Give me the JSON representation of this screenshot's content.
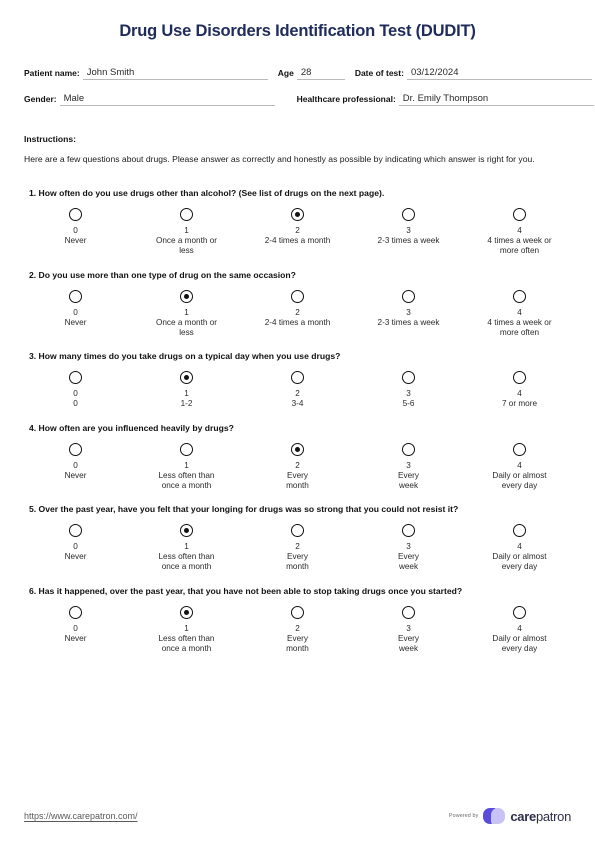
{
  "document": {
    "title": "Drug Use Disorders Identification Test (DUDIT)",
    "title_color": "#1f2b5b"
  },
  "header_fields": {
    "patient_name_label": "Patient name:",
    "patient_name_value": "John Smith",
    "age_label": "Age",
    "age_value": "28",
    "date_label": "Date of test:",
    "date_value": "03/12/2024",
    "gender_label": "Gender:",
    "gender_value": "Male",
    "professional_label": "Healthcare professional:",
    "professional_value": "Dr. Emily Thompson"
  },
  "instructions": {
    "heading": "Instructions:",
    "body": "Here are a few questions about drugs. Please answer as correctly and honestly as possible by indicating which answer is right for you."
  },
  "questions": [
    {
      "text": "1. How often do you use drugs other than alcohol? (See list of drugs on the next page).",
      "selected": 2,
      "options": [
        {
          "value": "0",
          "label": "Never"
        },
        {
          "value": "1",
          "label": "Once a month or\nless"
        },
        {
          "value": "2",
          "label": "2-4 times a month"
        },
        {
          "value": "3",
          "label": "2-3 times a week"
        },
        {
          "value": "4",
          "label": "4 times a week or\nmore often"
        }
      ]
    },
    {
      "text": "2. Do you use more than one type of drug on the same occasion?",
      "selected": 1,
      "options": [
        {
          "value": "0",
          "label": "Never"
        },
        {
          "value": "1",
          "label": "Once a month or\nless"
        },
        {
          "value": "2",
          "label": "2-4 times a month"
        },
        {
          "value": "3",
          "label": "2-3 times a week"
        },
        {
          "value": "4",
          "label": "4 times a week or\nmore often"
        }
      ]
    },
    {
      "text": "3. How many times do you take drugs on a typical day when you use drugs?",
      "selected": 1,
      "options": [
        {
          "value": "0",
          "label": "0"
        },
        {
          "value": "1",
          "label": "1-2"
        },
        {
          "value": "2",
          "label": "3-4"
        },
        {
          "value": "3",
          "label": "5-6"
        },
        {
          "value": "4",
          "label": "7 or more"
        }
      ]
    },
    {
      "text": "4. How often are you influenced heavily by drugs?",
      "selected": 2,
      "options": [
        {
          "value": "0",
          "label": "Never"
        },
        {
          "value": "1",
          "label": "Less often than\nonce a month"
        },
        {
          "value": "2",
          "label": "Every\nmonth"
        },
        {
          "value": "3",
          "label": "Every\nweek"
        },
        {
          "value": "4",
          "label": "Daily or almost\nevery day"
        }
      ]
    },
    {
      "text": "5. Over the past year, have you felt that your longing for drugs was so strong that you could not resist it?",
      "selected": 1,
      "options": [
        {
          "value": "0",
          "label": "Never"
        },
        {
          "value": "1",
          "label": "Less often than\nonce a month"
        },
        {
          "value": "2",
          "label": "Every\nmonth"
        },
        {
          "value": "3",
          "label": "Every\nweek"
        },
        {
          "value": "4",
          "label": "Daily or almost\nevery day"
        }
      ]
    },
    {
      "text": "6. Has it happened, over the past year, that you have not been able to stop taking drugs once you started?",
      "selected": 1,
      "options": [
        {
          "value": "0",
          "label": "Never"
        },
        {
          "value": "1",
          "label": "Less often than\nonce a month"
        },
        {
          "value": "2",
          "label": "Every\nmonth"
        },
        {
          "value": "3",
          "label": "Every\nweek"
        },
        {
          "value": "4",
          "label": "Daily or almost\nevery day"
        }
      ]
    }
  ],
  "footer": {
    "url": "https://www.carepatron.com/",
    "powered_by": "Powered by",
    "brand_bold": "care",
    "brand_light": "patron",
    "brand_dark_color": "#5b4bdb",
    "brand_light_color": "#c9c2f4"
  }
}
